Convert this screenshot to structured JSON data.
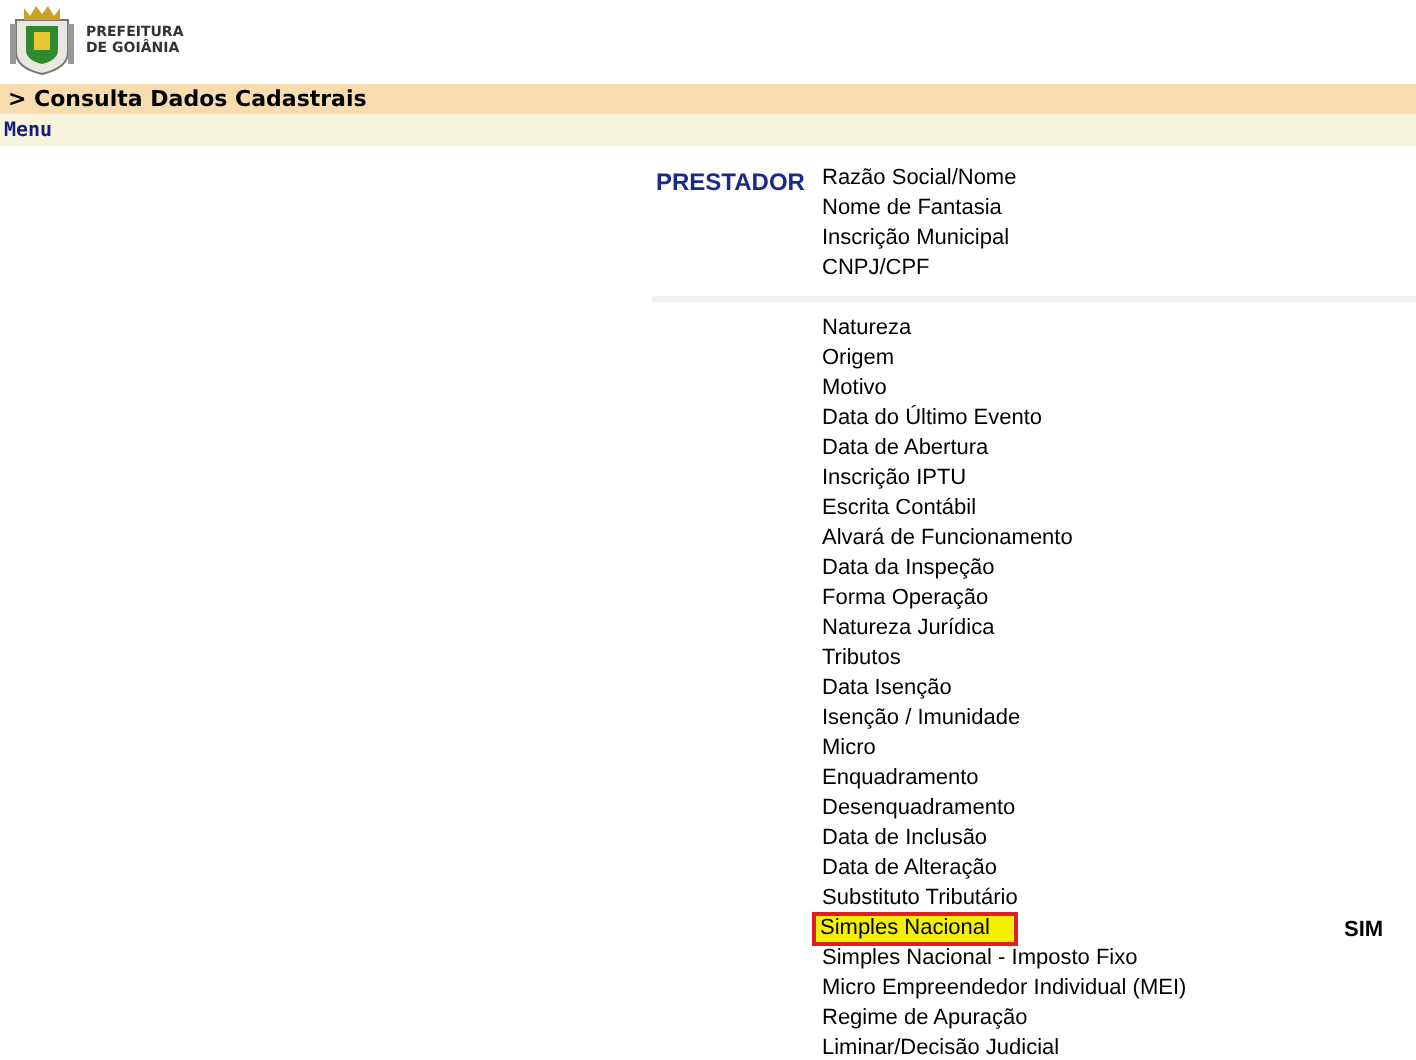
{
  "header": {
    "logo_lines": [
      "PREFEITURA",
      "DE GOIÂNIA"
    ]
  },
  "title_bar": {
    "title": "> Consulta Dados Cadastrais"
  },
  "menu_bar": {
    "label": "Menu"
  },
  "prestador": {
    "label": "PRESTADOR",
    "fields": [
      "Razão Social/Nome",
      "Nome de Fantasia",
      "Inscrição Municipal",
      "CNPJ/CPF"
    ]
  },
  "details": [
    {
      "label": "Natureza",
      "highlighted": false
    },
    {
      "label": "Origem",
      "highlighted": false
    },
    {
      "label": "Motivo",
      "highlighted": false
    },
    {
      "label": "Data do Último Evento",
      "highlighted": false
    },
    {
      "label": "Data de Abertura",
      "highlighted": false
    },
    {
      "label": "Inscrição IPTU",
      "highlighted": false
    },
    {
      "label": "Escrita Contábil",
      "highlighted": false
    },
    {
      "label": "Alvará de Funcionamento",
      "highlighted": false
    },
    {
      "label": "Data da Inspeção",
      "highlighted": false
    },
    {
      "label": "Forma Operação",
      "highlighted": false
    },
    {
      "label": "Natureza Jurídica",
      "highlighted": false
    },
    {
      "label": "Tributos",
      "highlighted": false
    },
    {
      "label": "Data Isenção",
      "highlighted": false
    },
    {
      "label": "Isenção / Imunidade",
      "highlighted": false
    },
    {
      "label": "Micro",
      "highlighted": false
    },
    {
      "label": "Enquadramento",
      "highlighted": false
    },
    {
      "label": "Desenquadramento",
      "highlighted": false
    },
    {
      "label": "Data de Inclusão",
      "highlighted": false
    },
    {
      "label": "Data de Alteração",
      "highlighted": false
    },
    {
      "label": "Substituto Tributário",
      "highlighted": false
    },
    {
      "label": "Simples Nacional",
      "highlighted": true,
      "value": "SIM"
    },
    {
      "label": "Simples Nacional - Imposto Fixo",
      "highlighted": false
    },
    {
      "label": "Micro Empreendedor Individual (MEI)",
      "highlighted": false
    },
    {
      "label": "Regime de Apuração",
      "highlighted": false
    },
    {
      "label": "Liminar/Decisão Judicial",
      "highlighted": false
    }
  ]
}
